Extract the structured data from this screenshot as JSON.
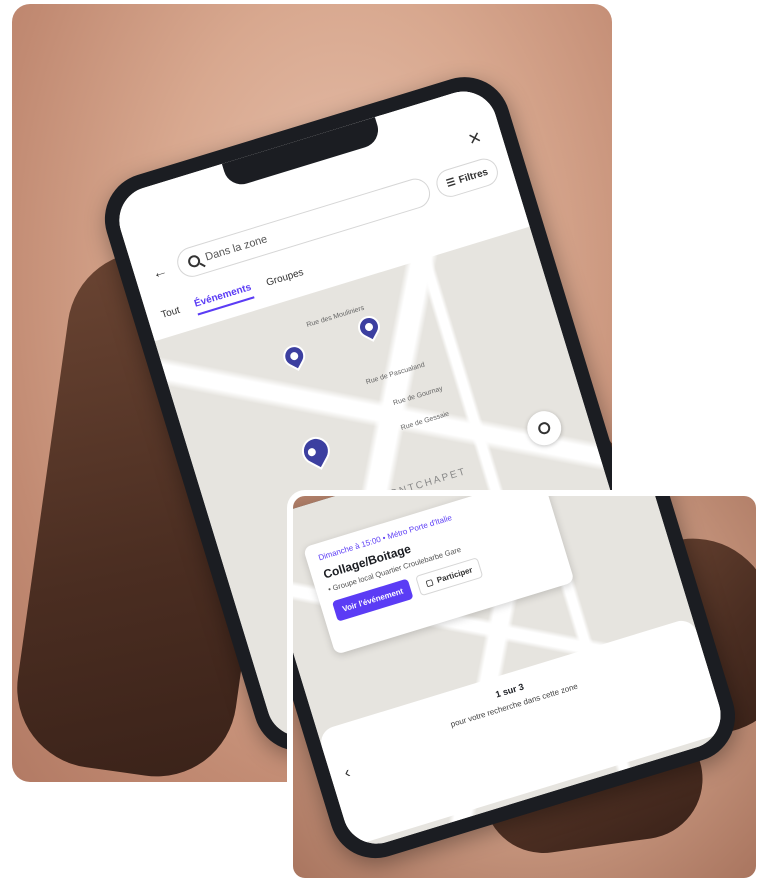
{
  "phone_screen": {
    "search": {
      "placeholder": "Dans la zone",
      "filters_label": "Filtres"
    },
    "tabs": [
      {
        "label": "Tout",
        "active": false
      },
      {
        "label": "Événements",
        "active": true
      },
      {
        "label": "Groupes",
        "active": false
      }
    ],
    "map": {
      "streets": [
        "Rue des Mouliniers",
        "Rue de Pascualand",
        "Rue de Gournay",
        "Rue de Gessaie"
      ],
      "district": "MONTCHAPET"
    }
  },
  "inset_card": {
    "date": "Dimanche à 15:00 • Métro Porte d'Italie",
    "title": "Collage/Boitage",
    "meta": "• Groupe local Quartier Croulebarbe Gare",
    "primary_action": "Voir l'événement",
    "secondary_action": "Participer"
  },
  "bottom_sheet": {
    "title": "1 sur 3",
    "text": "pour votre recherche dans cette zone"
  },
  "colors": {
    "accent": "#5b3cf5",
    "pin": "#3c3fa0"
  }
}
